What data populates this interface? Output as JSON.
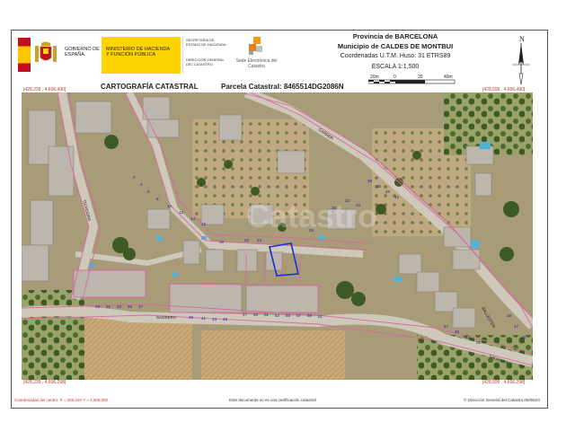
{
  "header": {
    "gov_label": "GOBIERNO DE ESPAÑA",
    "ministry_label": "MINISTERIO DE HACIENDA Y FUNCIÓN PÚBLICA",
    "secretaria_label": "SECRETARÍA DE ESTADO DE HACIENDA",
    "direccion_label": "DIRECCIÓN GENERAL DEL CATASTRO",
    "sede_label": "Sede Electrónica del Catastro",
    "province": "Provincia de BARCELONA",
    "municipality": "Municipio de CALDES DE MONTBUI",
    "coords": "Coordenadas U.T.M. Huso: 31 ETRS89",
    "scale": "ESCALA 1:1,500",
    "scale_ticks": [
      "20m",
      "0",
      "20",
      "40m"
    ],
    "north_label": "N"
  },
  "titles": {
    "cartography": "CARTOGRAFÍA CATASTRAL",
    "parcel": "Parcela Catastral: 8465514DG2086N"
  },
  "corners": {
    "top_left": "[428,239 , 4,606,490]",
    "top_right": "[428,599 , 4,606,490]",
    "bottom_left": "[428,239 , 4,606,298]",
    "bottom_right": "[428,599 , 4,606,298]"
  },
  "map": {
    "streets": [
      "CARRER",
      "SAGRERA",
      "TEIXIDORA",
      "BALLESTER",
      "SAGRERA"
    ],
    "labels": [
      "42",
      "40",
      "38",
      "36",
      "34",
      "32",
      "30",
      "26",
      "24",
      "22",
      "18",
      "16",
      "14",
      "12",
      "10",
      "8",
      "6",
      "4",
      "2",
      "61",
      "59",
      "57",
      "55",
      "53",
      "51",
      "49",
      "47",
      "45",
      "43",
      "41",
      "39",
      "37",
      "35",
      "33",
      "31",
      "29",
      "27",
      "25",
      "23",
      "21",
      "19",
      "17",
      "15"
    ],
    "watermark": "Catastro",
    "colors": {
      "parcel_line": "#d86aa0",
      "selected_parcel": "#1a2fd6"
    }
  },
  "footer": {
    "center_coords": "Coordenadas del centro: X = 428,419 Y = 4,606,392",
    "disclaimer": "Este documento no es una certificación catastral",
    "copyright": "© Dirección General del Catastro 05/06/23"
  }
}
